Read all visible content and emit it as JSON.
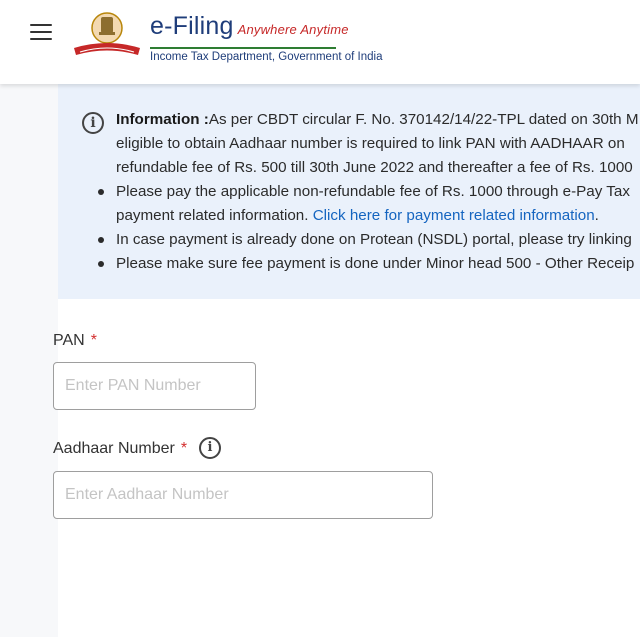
{
  "header": {
    "brand_title": "e-Filing",
    "brand_tagline": "Anywhere Anytime",
    "brand_subtitle": "Income Tax Department, Government of India",
    "menu_icon": "hamburger-icon",
    "logo_icon": "national-emblem-logo"
  },
  "info": {
    "icon": "info-icon",
    "heading": "Information :",
    "line1": "As per CBDT circular F. No. 370142/14/22-TPL dated on 30th M",
    "line2": "eligible to obtain Aadhaar number is required to link PAN with AADHAAR on",
    "line3": "refundable fee of Rs. 500 till 30th June 2022 and thereafter a fee of Rs. 1000",
    "bullets": [
      {
        "text_a": "Please pay the applicable non-refundable fee of Rs. 1000 through e-Pay Tax",
        "text_b": "payment related information.",
        "link": "Click here for payment related information",
        "text_c": "."
      },
      {
        "text": "In case payment is already done on Protean (NSDL) portal, please try linking"
      },
      {
        "text": "Please make sure fee payment is done under Minor head 500 - Other Receip"
      }
    ]
  },
  "form": {
    "pan_label": "PAN",
    "pan_required": "*",
    "pan_placeholder": "Enter PAN Number",
    "aadhaar_label": "Aadhaar Number",
    "aadhaar_required": "*",
    "aadhaar_help_icon": "info-icon",
    "aadhaar_placeholder": "Enter Aadhaar Number"
  },
  "colors": {
    "brand_blue": "#1f3d7a",
    "tagline_red": "#c62828",
    "info_bg": "#eaf1fb",
    "link_blue": "#1565c0",
    "required_red": "#d32f2f"
  }
}
